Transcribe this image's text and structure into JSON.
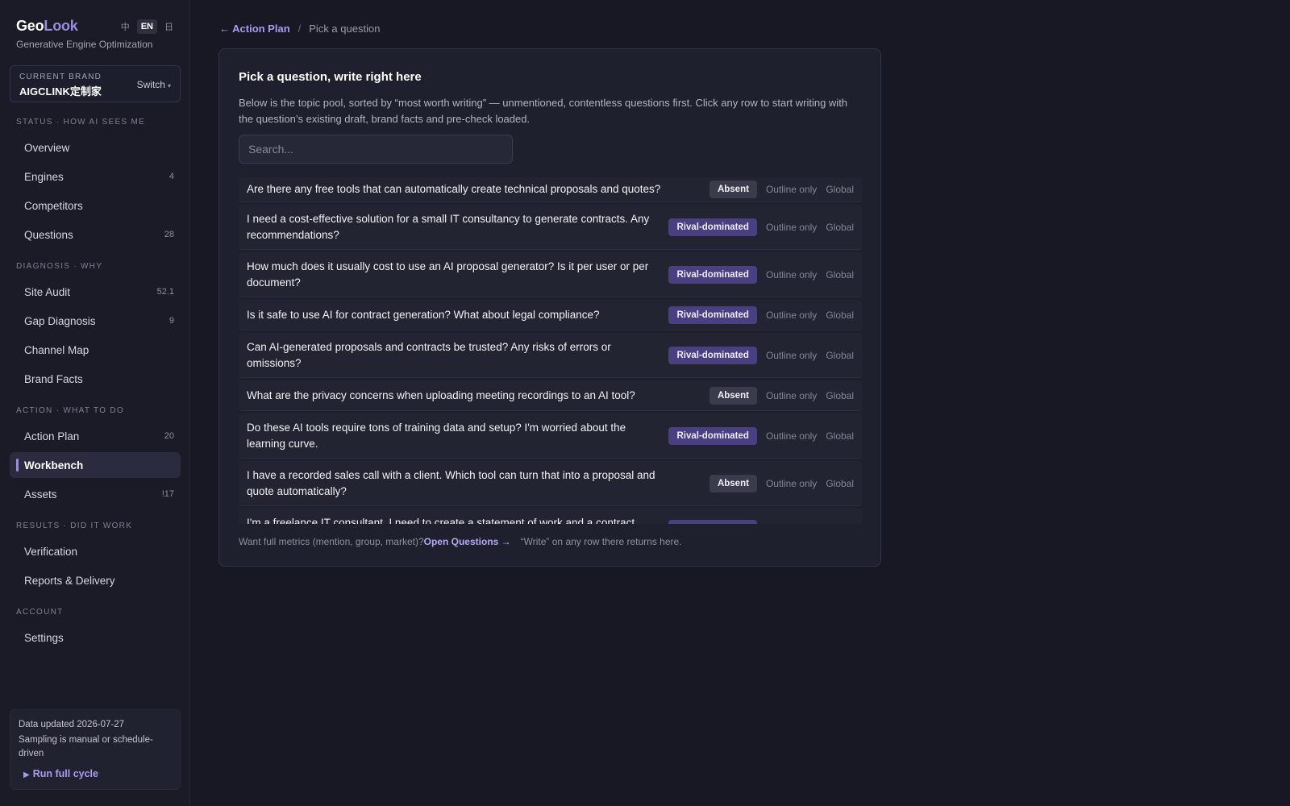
{
  "sidebar": {
    "logo_part1": "Geo",
    "logo_part2": "Look",
    "tagline": "Generative Engine Optimization",
    "lang": [
      "中",
      "EN",
      "日"
    ],
    "brand_card": {
      "label": "CURRENT BRAND",
      "name": "AIGCLINK定制家",
      "switch_label": "Switch"
    },
    "sections": [
      {
        "heading": "STATUS · HOW AI SEES ME",
        "items": [
          {
            "label": "Overview",
            "count": ""
          },
          {
            "label": "Engines",
            "count": "4"
          },
          {
            "label": "Competitors",
            "count": ""
          },
          {
            "label": "Questions",
            "count": "28"
          }
        ]
      },
      {
        "heading": "DIAGNOSIS · WHY",
        "items": [
          {
            "label": "Site Audit",
            "count": "52.1"
          },
          {
            "label": "Gap Diagnosis",
            "count": "9"
          },
          {
            "label": "Channel Map",
            "count": ""
          },
          {
            "label": "Brand Facts",
            "count": ""
          }
        ]
      },
      {
        "heading": "ACTION · WHAT TO DO",
        "items": [
          {
            "label": "Action Plan",
            "count": "20"
          },
          {
            "label": "Workbench",
            "count": ""
          },
          {
            "label": "Assets",
            "count": "!17"
          }
        ]
      },
      {
        "heading": "RESULTS · DID IT WORK",
        "items": [
          {
            "label": "Verification",
            "count": ""
          },
          {
            "label": "Reports & Delivery",
            "count": ""
          }
        ]
      },
      {
        "heading": "ACCOUNT",
        "items": [
          {
            "label": "Settings",
            "count": ""
          }
        ]
      }
    ],
    "footer": {
      "updated": "Data updated 2026-07-27",
      "sampling": "Sampling is manual or schedule-driven",
      "run_label": "Run full cycle"
    }
  },
  "breadcrumb": {
    "back": "← Action Plan",
    "sep": "/",
    "current": "Pick a question"
  },
  "panel": {
    "title": "Pick a question, write right here",
    "description": "Below is the topic pool, sorted by “most worth writing” — unmentioned, contentless questions first. Click any row to start writing with the question’s existing draft, brand facts and pre-check loaded.",
    "search_placeholder": "Search...",
    "questions": [
      {
        "text": "Are there any free tools that can automatically create technical proposals and quotes?",
        "status": "Absent",
        "content": "Outline only",
        "market": "Global"
      },
      {
        "text": "I need a cost-effective solution for a small IT consultancy to generate contracts. Any recommendations?",
        "status": "Rival-dominated",
        "content": "Outline only",
        "market": "Global"
      },
      {
        "text": "How much does it usually cost to use an AI proposal generator? Is it per user or per document?",
        "status": "Rival-dominated",
        "content": "Outline only",
        "market": "Global"
      },
      {
        "text": "Is it safe to use AI for contract generation? What about legal compliance?",
        "status": "Rival-dominated",
        "content": "Outline only",
        "market": "Global"
      },
      {
        "text": "Can AI-generated proposals and contracts be trusted? Any risks of errors or omissions?",
        "status": "Rival-dominated",
        "content": "Outline only",
        "market": "Global"
      },
      {
        "text": "What are the privacy concerns when uploading meeting recordings to an AI tool?",
        "status": "Absent",
        "content": "Outline only",
        "market": "Global"
      },
      {
        "text": "Do these AI tools require tons of training data and setup? I'm worried about the learning curve.",
        "status": "Rival-dominated",
        "content": "Outline only",
        "market": "Global"
      },
      {
        "text": "I have a recorded sales call with a client. Which tool can turn that into a proposal and quote automatically?",
        "status": "Absent",
        "content": "Outline only",
        "market": "Global"
      },
      {
        "text": "I'm a freelance IT consultant. I need to create a statement of work and a contract",
        "status": "Rival-dominated",
        "content": "Outline only",
        "market": "Global"
      }
    ],
    "footer": {
      "prompt": "Want full metrics (mention, group, market)?",
      "link": "Open Questions →",
      "note": "“Write” on any row there returns here."
    }
  },
  "colors": {
    "accent": "#9b8ce0",
    "background": "#171823",
    "rival_badge": "#4a3f80",
    "absent_badge": "#3a3b4c"
  }
}
